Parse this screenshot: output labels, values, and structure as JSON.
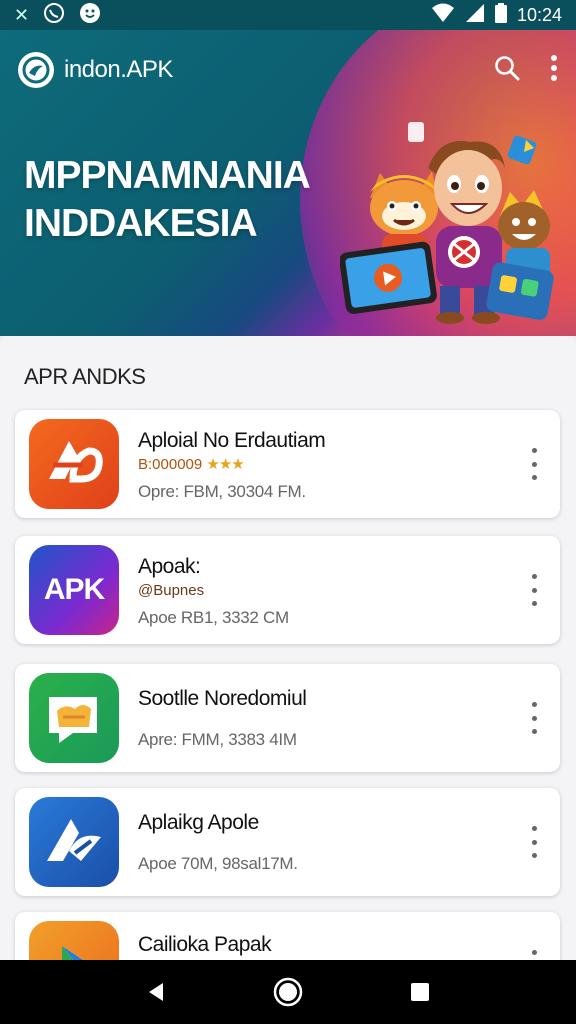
{
  "status_bar": {
    "time": "10:24",
    "icons": [
      "x-notification-icon",
      "whatsapp-icon",
      "smiley-icon",
      "wifi-icon",
      "signal-icon",
      "battery-icon"
    ]
  },
  "app_bar": {
    "title": "indon.APK",
    "search_icon": "search-icon",
    "menu_icon": "more-vert-icon"
  },
  "hero": {
    "headline_line1": "MPPNAMNANIA",
    "headline_line2": "INDDAKESIA"
  },
  "section": {
    "title": "APR ANDKS"
  },
  "apps": [
    {
      "name": "Aploial No Erdautiam",
      "sub": "B:000009",
      "stars": "★★★",
      "meta": "Opre: FBM, 30304 FM.",
      "icon": "ap-orange-logo-icon"
    },
    {
      "name": "Apoak:",
      "sub": "@Bupnes",
      "stars": "",
      "meta": "Apoe RB1, 3332 CM",
      "icon": "apk-purple-logo-icon",
      "icon_text": "APK"
    },
    {
      "name": "Sootlle Noredomiul",
      "sub": "",
      "stars": "",
      "meta": "Apre: FMM, 3383 4IM",
      "icon": "green-chat-logo-icon"
    },
    {
      "name": "Aplaikg Apole",
      "sub": "",
      "stars": "",
      "meta": "Apoe 70M, 98sal17M.",
      "icon": "blue-a-logo-icon"
    },
    {
      "name": "Cailioka Papak",
      "sub": "",
      "stars": "",
      "meta": "",
      "icon": "play-logo-icon"
    }
  ],
  "colors": {
    "status_bar": "#0a4f5c",
    "accent_orange": "#f05a1e",
    "star": "#e8a317"
  },
  "nav": [
    "back-icon",
    "home-icon",
    "recents-icon"
  ]
}
